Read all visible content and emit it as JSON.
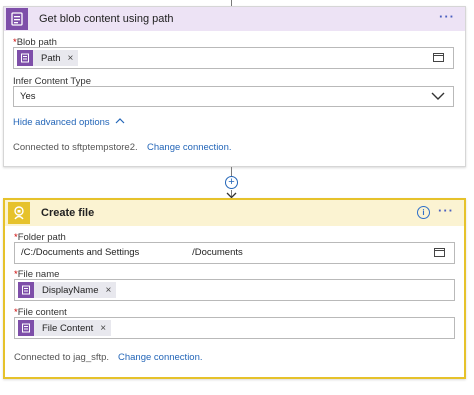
{
  "step1": {
    "title": "Get blob content using path",
    "more_label": "···",
    "blob_path": {
      "required_mark": "*",
      "label": "Blob path",
      "token": "Path",
      "remove": "×"
    },
    "infer_content_type": {
      "label": "Infer Content Type",
      "value": "Yes"
    },
    "advanced_toggle": "Hide advanced options",
    "connected_text": "Connected to sftptempstore2.",
    "change_connection": "Change connection."
  },
  "connector": {
    "plus": "+"
  },
  "step2": {
    "title": "Create file",
    "info_label": "i",
    "more_label": "···",
    "folder_path": {
      "required_mark": "*",
      "label": "Folder path",
      "value": "/C:/Documents and Settings                    /Documents"
    },
    "file_name": {
      "required_mark": "*",
      "label": "File name",
      "token": "DisplayName",
      "remove": "×"
    },
    "file_content": {
      "required_mark": "*",
      "label": "File content",
      "token": "File Content",
      "remove": "×"
    },
    "connected_text": "Connected to jag_sftp.",
    "change_connection": "Change connection."
  },
  "colors": {
    "step1_header_bg": "#ede3f5",
    "step1_icon_bg": "#7e4fa9",
    "step2_border": "#e6c22b",
    "step2_header_bg": "#fbf3d2",
    "link": "#2466b8"
  },
  "icons": {
    "step1": "blob-storage-icon",
    "step2": "sftp-icon",
    "token": "blob-token-icon",
    "browse": "file-browse-icon",
    "dropdown": "chevron-down-icon",
    "advanced": "chevron-up-icon"
  }
}
